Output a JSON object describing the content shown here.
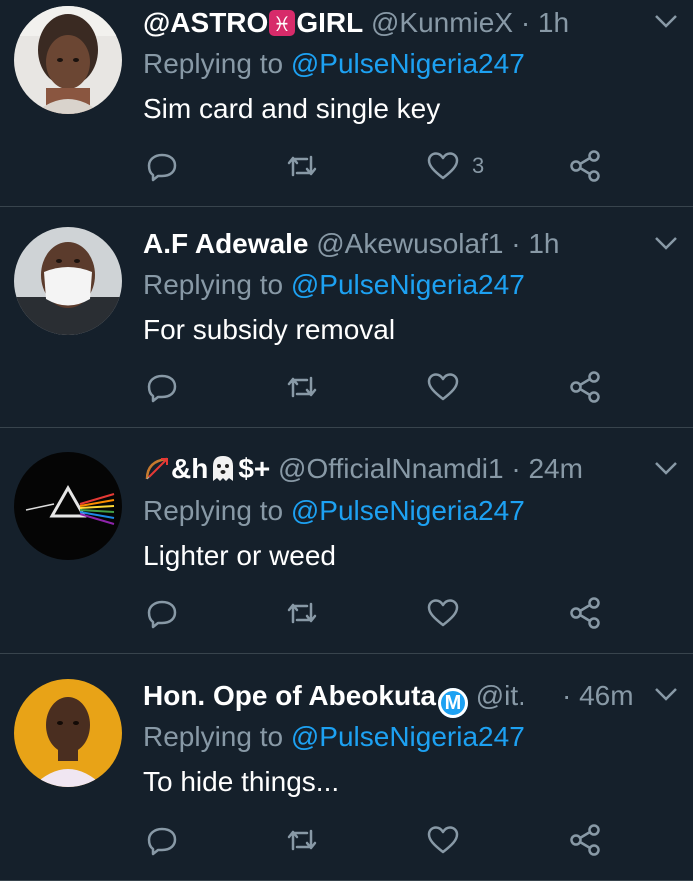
{
  "tweets": [
    {
      "name_parts": [
        "@ASTRO",
        "GIRL"
      ],
      "name_emoji": "pisces-emoji",
      "handle": "@KunmieX",
      "dot": "·",
      "time": "1h",
      "replying_label": "Replying to",
      "mention": "@PulseNigeria247",
      "text": "Sim card and single key",
      "like_count": "3"
    },
    {
      "name": "A.F Adewale",
      "handle": "@Akewusolaf1",
      "dot": "·",
      "time": "1h",
      "replying_label": "Replying to",
      "mention": "@PulseNigeria247",
      "text": "For subsidy removal",
      "like_count": ""
    },
    {
      "name_suffix_a": "&h",
      "name_suffix_b": "$+",
      "name_emojis": [
        "bow-and-arrow-emoji",
        "ghost-emoji"
      ],
      "handle": "@OfficialNnamdi1",
      "dot": "·",
      "time": "24m",
      "replying_label": "Replying to",
      "mention": "@PulseNigeria247",
      "text": "Lighter or weed",
      "like_count": ""
    },
    {
      "name": "Hon. Ope of Abeokuta",
      "badge": "M",
      "handle": "@it...",
      "dot": "·",
      "time": "46m",
      "replying_label": "Replying to",
      "mention": "@PulseNigeria247",
      "text": "To hide things...",
      "like_count": ""
    }
  ],
  "icons": {
    "reply": "reply-icon",
    "retweet": "retweet-icon",
    "like": "heart-icon",
    "share": "share-icon",
    "more": "chevron-down-icon"
  },
  "colors": {
    "background": "#15202b",
    "secondary_text": "#8899a6",
    "mention": "#1da1f2",
    "divider": "#38444d"
  }
}
